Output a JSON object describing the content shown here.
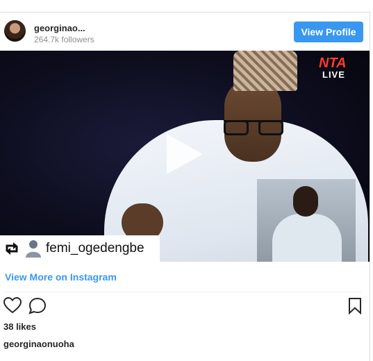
{
  "header": {
    "username": "georginao...",
    "followers": "264.7k followers",
    "view_profile_label": "View Profile"
  },
  "media": {
    "channel_logo": "NTA",
    "channel_live": "LIVE",
    "repost_username": "femi_ogedengbe"
  },
  "view_more_label": "View More on Instagram",
  "likes": "38 likes",
  "caption_username": "georginaonuoha",
  "icons": {
    "like": "heart-icon",
    "comment": "comment-icon",
    "save": "bookmark-icon",
    "play": "play-icon",
    "repost": "repost-icon"
  },
  "colors": {
    "accent": "#3897f0",
    "text": "#262626",
    "muted": "#8e8e8e"
  }
}
